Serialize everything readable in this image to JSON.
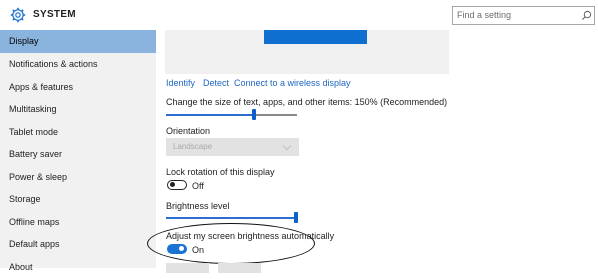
{
  "window": {
    "title": "SYSTEM"
  },
  "search": {
    "placeholder": "Find a setting"
  },
  "sidebar": {
    "items": [
      {
        "label": "Display",
        "selected": true
      },
      {
        "label": "Notifications & actions"
      },
      {
        "label": "Apps & features"
      },
      {
        "label": "Multitasking"
      },
      {
        "label": "Tablet mode"
      },
      {
        "label": "Battery saver"
      },
      {
        "label": "Power & sleep"
      },
      {
        "label": "Storage"
      },
      {
        "label": "Offline maps"
      },
      {
        "label": "Default apps"
      },
      {
        "label": "About"
      }
    ]
  },
  "display": {
    "links": {
      "identify": "Identify",
      "detect": "Detect",
      "wireless": "Connect to a wireless display"
    },
    "scale_label": "Change the size of text, apps, and other items: 150% (Recommended)",
    "scale_level": 0.67,
    "orientation_label": "Orientation",
    "orientation_value": "Landscape",
    "lock_rotation_label": "Lock rotation of this display",
    "lock_rotation_state": "Off",
    "brightness_label": "Brightness level",
    "brightness_level": 1.0,
    "auto_brightness_label": "Adjust my screen brightness automatically",
    "auto_brightness_state": "On"
  },
  "colors": {
    "accent": "#0f6fd1",
    "selection": "#8ab4de",
    "link": "#1e66c1"
  },
  "icons": {
    "app": "gear-icon",
    "search": "search-icon"
  }
}
